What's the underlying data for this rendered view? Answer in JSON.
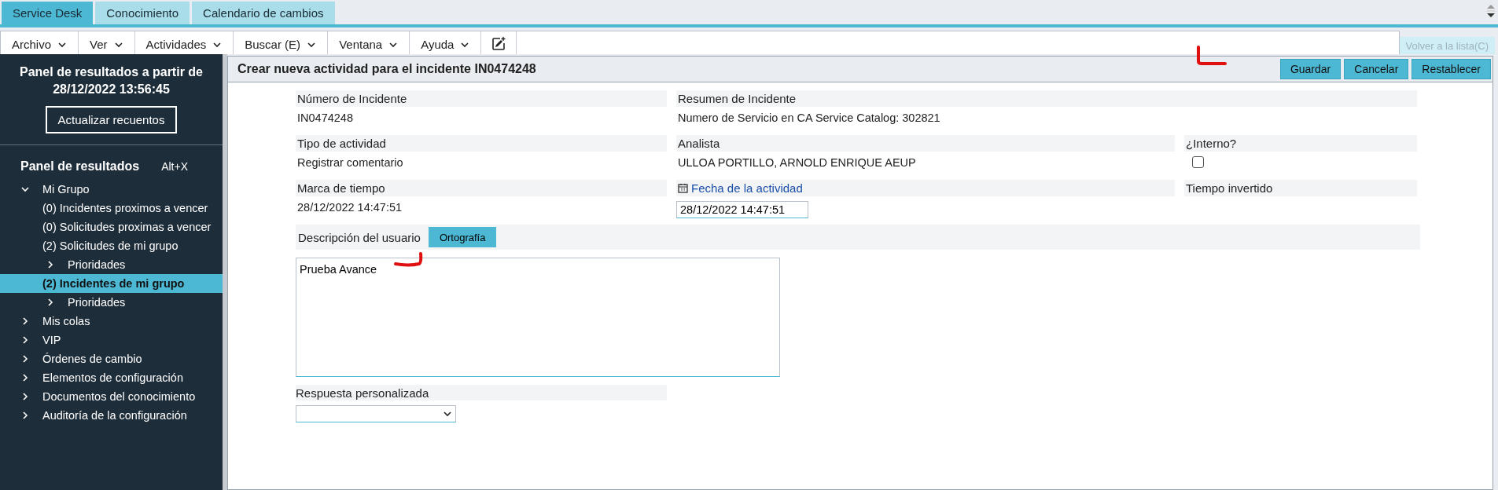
{
  "top_tabs": [
    {
      "label": "Service Desk",
      "selected": true
    },
    {
      "label": "Conocimiento",
      "selected": false
    },
    {
      "label": "Calendario de cambios",
      "selected": false
    }
  ],
  "menu": [
    {
      "label": "Archivo"
    },
    {
      "label": "Ver"
    },
    {
      "label": "Actividades"
    },
    {
      "label": "Buscar (E)"
    },
    {
      "label": "Ventana"
    },
    {
      "label": "Ayuda"
    }
  ],
  "back_link": {
    "label": "Volver a la lista(C)",
    "disabled": true
  },
  "sidebar": {
    "title": "Panel de resultados a partir de 28/12/2022 13:56:45",
    "refresh_button": "Actualizar recuentos",
    "section_title": "Panel de resultados",
    "shortcut": "Alt+X",
    "items": [
      {
        "label": "Mi Grupo",
        "expanded": true,
        "selected": false,
        "children": [
          {
            "label": "(0) Incidentes proximos a vencer",
            "selected": false
          },
          {
            "label": "(0) Solicitudes proximas a vencer",
            "selected": false
          },
          {
            "label": "(2) Solicitudes de mi grupo",
            "selected": false,
            "children": [
              {
                "label": "Prioridades",
                "expanded": false,
                "selected": false
              }
            ]
          },
          {
            "label": "(2) Incidentes de mi grupo",
            "selected": true,
            "children": [
              {
                "label": "Prioridades",
                "expanded": false,
                "selected": false
              }
            ]
          }
        ]
      },
      {
        "label": "Mis colas",
        "expanded": false,
        "selected": false
      },
      {
        "label": "VIP",
        "expanded": false,
        "selected": false
      },
      {
        "label": "Órdenes de cambio",
        "expanded": false,
        "selected": false
      },
      {
        "label": "Elementos de configuración",
        "expanded": false,
        "selected": false
      },
      {
        "label": "Documentos del conocimiento",
        "expanded": false,
        "selected": false
      },
      {
        "label": "Auditoría de la configuración",
        "expanded": false,
        "selected": false
      }
    ]
  },
  "form": {
    "title": "Crear nueva actividad para el incidente IN0474248",
    "buttons": [
      "Guardar",
      "Cancelar",
      "Restablecer"
    ],
    "rows": [
      [
        {
          "kind": "text",
          "label": "Número de Incidente",
          "value": "IN0474248"
        },
        {
          "kind": "text",
          "label": "Resumen de Incidente",
          "value": "Numero de Servicio en CA Service Catalog: 302821"
        }
      ],
      [
        {
          "kind": "text",
          "label": "Tipo de actividad",
          "value": "Registrar comentario"
        },
        {
          "kind": "text",
          "label": "Analista",
          "value": "ULLOA PORTILLO, ARNOLD ENRIQUE AEUP"
        },
        {
          "kind": "checkbox",
          "label": "¿Interno?",
          "checked": false
        }
      ],
      [
        {
          "kind": "text",
          "label": "Marca de tiempo",
          "value": "28/12/2022 14:47:51"
        },
        {
          "kind": "date",
          "label": "Fecha de la actividad",
          "value": "28/12/2022 14:47:51"
        },
        {
          "kind": "empty",
          "label": "Tiempo invertido"
        }
      ]
    ],
    "description": {
      "label": "Descripción del usuario",
      "spell_button": "Ortografía",
      "value": "Prueba Avance"
    },
    "custom_response": {
      "label": "Respuesta personalizada"
    }
  }
}
